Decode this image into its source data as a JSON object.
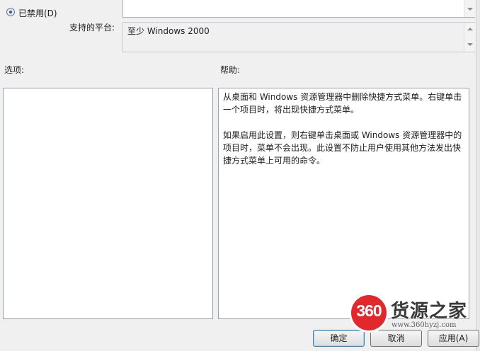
{
  "radio": {
    "label": "已禁用(D)"
  },
  "platform": {
    "label": "支持的平台:",
    "value": "至少 Windows 2000"
  },
  "sections": {
    "options_label": "选项:",
    "help_label": "帮助:"
  },
  "help": {
    "paragraph1": "从桌面和 Windows 资源管理器中删除快捷方式菜单。右键单击一个项目时，将出现快捷方式菜单。",
    "paragraph2": "如果启用此设置，则右键单击桌面或 Windows 资源管理器中的项目时，菜单不会出现。此设置不防止用户使用其他方法发出快捷方式菜单上可用的命令。"
  },
  "buttons": {
    "ok": "确定",
    "cancel": "取消",
    "apply": "应用(A)"
  },
  "watermark": {
    "badge": "360",
    "title": "货源之家",
    "url": "www.360hyzj.com"
  }
}
